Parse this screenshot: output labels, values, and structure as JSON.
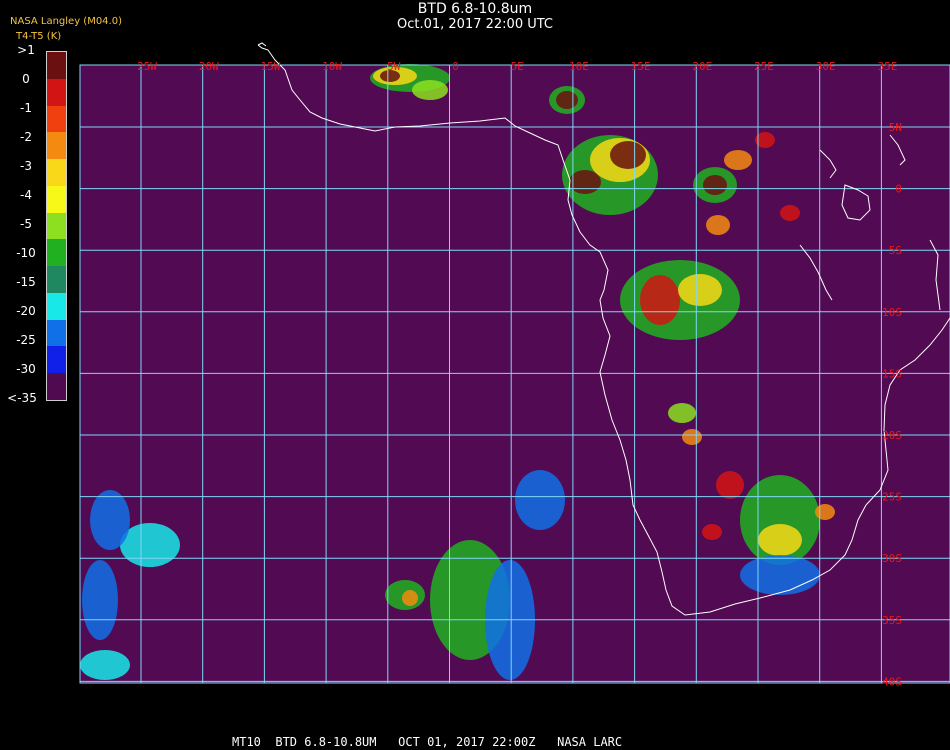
{
  "header": {
    "title": "BTD 6.8-10.8um",
    "subtitle": "Oct.01, 2017 22:00 UTC",
    "credit": "NASA Langley (M04.0)",
    "units": "T4-T5 (K)"
  },
  "colorbar": {
    "labels": [
      ">1",
      "0",
      "-1",
      "-2",
      "-3",
      "-4",
      "-5",
      "-10",
      "-15",
      "-20",
      "-25",
      "-30",
      "<-35"
    ],
    "colors": [
      "#6b1010",
      "#d21414",
      "#f04010",
      "#f48a10",
      "#f8d818",
      "#f8f818",
      "#8ce020",
      "#20b020",
      "#208860",
      "#18e8e8",
      "#1070e8",
      "#1020e8",
      "#500a50"
    ]
  },
  "map": {
    "background_color": "#520a52",
    "grid_color": "#7fd8f8",
    "coast_color": "#ffffff",
    "lon_labels": [
      "25W",
      "20W",
      "15W",
      "10W",
      "5W",
      "0",
      "5E",
      "10E",
      "15E",
      "20E",
      "25E",
      "30E",
      "35E"
    ],
    "lat_labels": [
      "5N",
      "0",
      "5S",
      "10S",
      "15S",
      "20S",
      "25S",
      "30S",
      "35S",
      "40S"
    ],
    "label_color": "#e81818"
  },
  "footer": {
    "text": "MT10  BTD 6.8-10.8UM   OCT 01, 2017 22:00Z   NASA LARC"
  }
}
